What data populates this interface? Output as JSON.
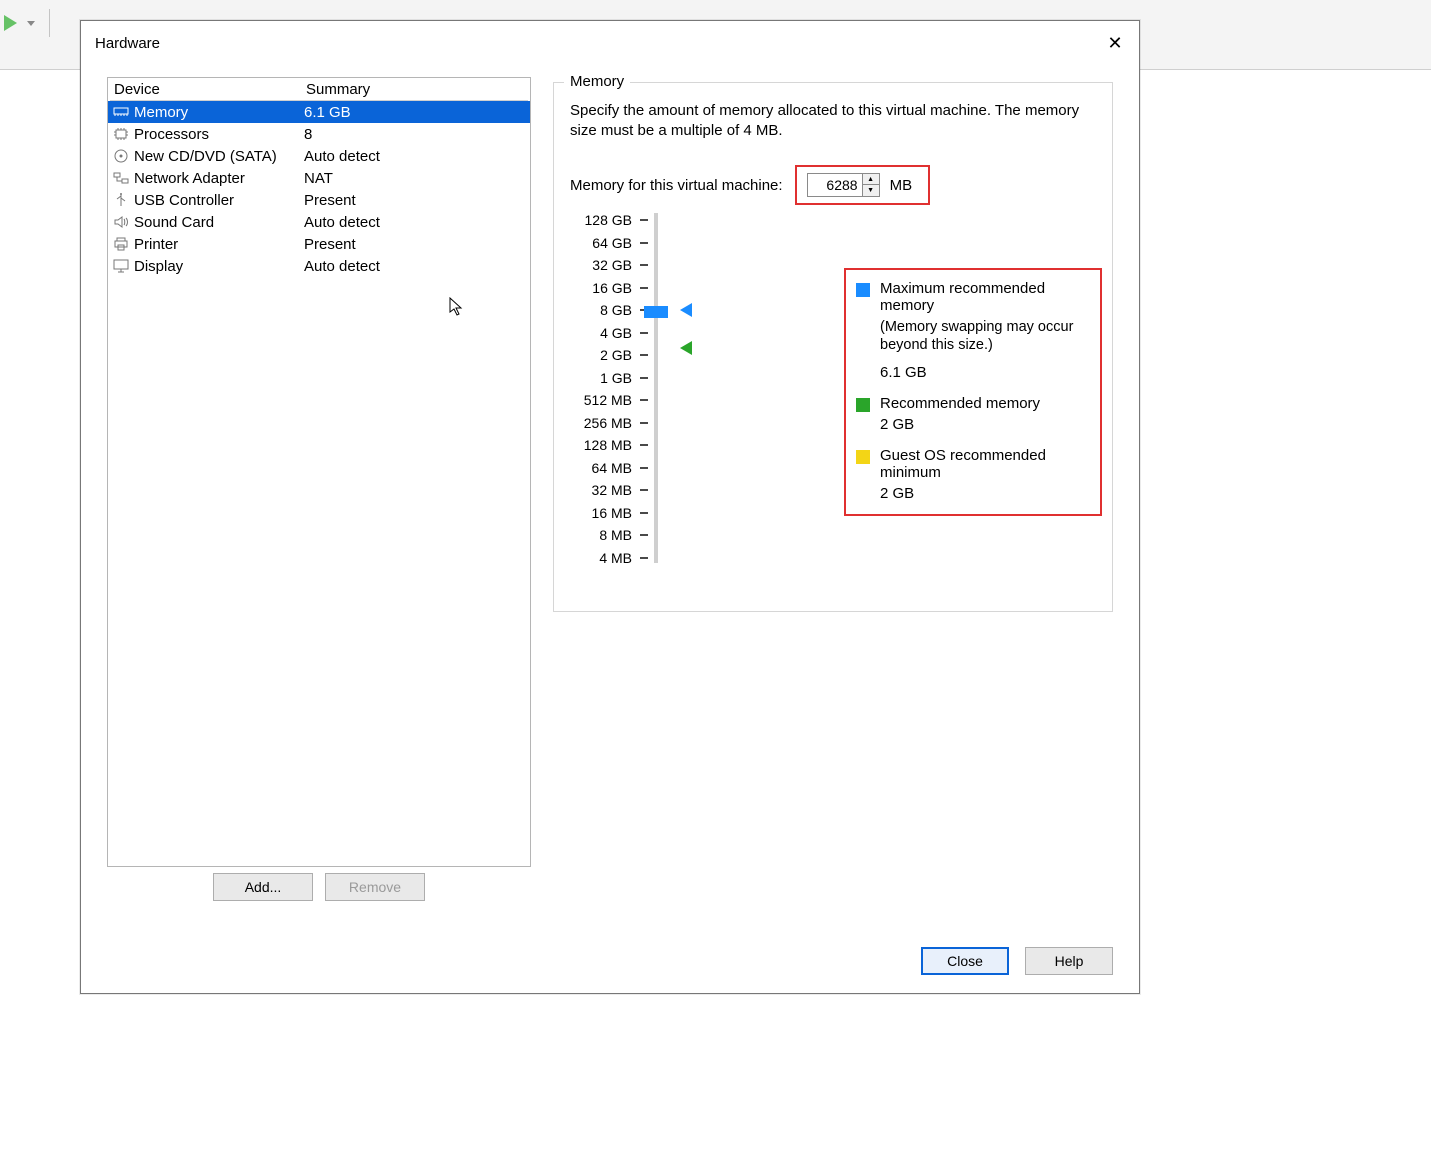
{
  "dialog": {
    "title": "Hardware"
  },
  "device_table": {
    "header_device": "Device",
    "header_summary": "Summary",
    "rows": [
      {
        "name": "Memory",
        "summary": "6.1 GB",
        "icon": "memory-icon",
        "selected": true
      },
      {
        "name": "Processors",
        "summary": "8",
        "icon": "cpu-icon",
        "selected": false
      },
      {
        "name": "New CD/DVD (SATA)",
        "summary": "Auto detect",
        "icon": "disc-icon",
        "selected": false
      },
      {
        "name": "Network Adapter",
        "summary": "NAT",
        "icon": "network-icon",
        "selected": false
      },
      {
        "name": "USB Controller",
        "summary": "Present",
        "icon": "usb-icon",
        "selected": false
      },
      {
        "name": "Sound Card",
        "summary": "Auto detect",
        "icon": "sound-icon",
        "selected": false
      },
      {
        "name": "Printer",
        "summary": "Present",
        "icon": "printer-icon",
        "selected": false
      },
      {
        "name": "Display",
        "summary": "Auto detect",
        "icon": "display-icon",
        "selected": false
      }
    ]
  },
  "left_buttons": {
    "add": "Add...",
    "remove": "Remove"
  },
  "memory": {
    "group_label": "Memory",
    "description": "Specify the amount of memory allocated to this virtual machine. The memory size must be a multiple of 4 MB.",
    "field_label": "Memory for this virtual machine:",
    "value": "6288",
    "unit": "MB",
    "scale_ticks": [
      "128 GB",
      "64 GB",
      "32 GB",
      "16 GB",
      "8 GB",
      "4 GB",
      "2 GB",
      "1 GB",
      "512 MB",
      "256 MB",
      "128 MB",
      "64 MB",
      "32 MB",
      "16 MB",
      "8 MB",
      "4 MB"
    ],
    "legend": {
      "max_label": "Maximum recommended memory",
      "max_note": "(Memory swapping may occur beyond this size.)",
      "max_value": "6.1 GB",
      "rec_label": "Recommended memory",
      "rec_value": "2 GB",
      "min_label": "Guest OS recommended minimum",
      "min_value": "2 GB"
    },
    "legend_colors": {
      "max": "#1a8cff",
      "rec": "#2aa52a",
      "min": "#f3d516"
    }
  },
  "footer": {
    "close": "Close",
    "help": "Help"
  }
}
